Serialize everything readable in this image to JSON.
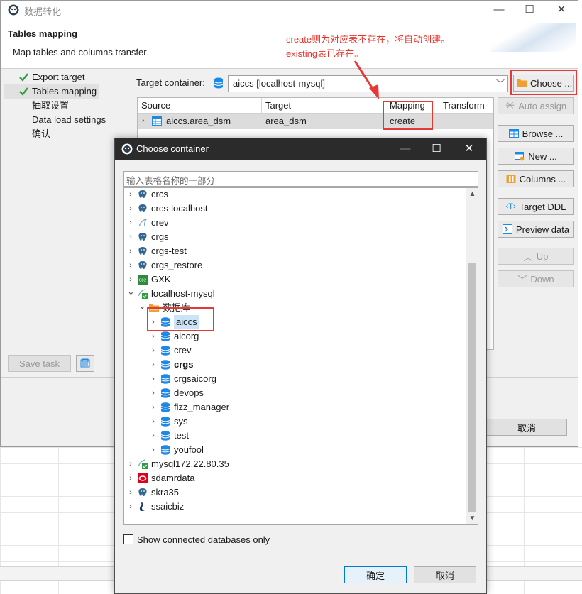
{
  "window": {
    "title": "数据转化",
    "controls": [
      "—",
      "☐",
      "✕"
    ]
  },
  "header": {
    "title": "Tables mapping",
    "subtitle": "Map tables and columns transfer"
  },
  "annotation": {
    "line1": "create则为对应表不存在，将自动创建。",
    "line2": "existing表已存在。"
  },
  "steps": [
    {
      "label": "Export target",
      "done": true
    },
    {
      "label": "Tables mapping",
      "done": true,
      "active": true
    },
    {
      "label": "抽取设置",
      "done": false
    },
    {
      "label": "Data load settings",
      "done": false
    },
    {
      "label": "确认",
      "done": false
    }
  ],
  "target_container": {
    "label": "Target container:",
    "value": "aiccs  [localhost-mysql]"
  },
  "choose_button": "Choose ...",
  "table": {
    "columns": [
      "Source",
      "Target",
      "Mapping",
      "Transform"
    ],
    "rows": [
      {
        "source": "aiccs.area_dsm",
        "target": "area_dsm",
        "mapping": "create",
        "transform": ""
      }
    ]
  },
  "right_buttons": {
    "auto_assign": "Auto assign",
    "browse": "Browse ...",
    "new": "New ...",
    "columns": "Columns ...",
    "target_ddl": "Target DDL",
    "preview": "Preview data",
    "up": "Up",
    "down": "Down"
  },
  "save_task": "Save task",
  "main_cancel": "取消",
  "dialog": {
    "title": "Choose container",
    "filter_placeholder": "输入表格名称的一部分",
    "tree": [
      {
        "label": "crcs",
        "icon": "postgres"
      },
      {
        "label": "crcs-localhost",
        "icon": "postgres"
      },
      {
        "label": "crev",
        "icon": "mysql"
      },
      {
        "label": "crgs",
        "icon": "postgres"
      },
      {
        "label": "crgs-test",
        "icon": "postgres"
      },
      {
        "label": "crgs_restore",
        "icon": "postgres"
      },
      {
        "label": "GXK",
        "icon": "green"
      },
      {
        "label": "localhost-mysql",
        "icon": "mysql-connected",
        "expanded": true
      },
      {
        "label": "数据库",
        "icon": "folder",
        "expanded": true
      },
      {
        "label": "aiccs",
        "icon": "database",
        "selected": true
      },
      {
        "label": "aicorg",
        "icon": "database"
      },
      {
        "label": "crev",
        "icon": "database"
      },
      {
        "label": "crgs",
        "icon": "database",
        "bold": true
      },
      {
        "label": "crgsaicorg",
        "icon": "database"
      },
      {
        "label": "devops",
        "icon": "database"
      },
      {
        "label": "fizz_manager",
        "icon": "database"
      },
      {
        "label": "sys",
        "icon": "database"
      },
      {
        "label": "test",
        "icon": "database"
      },
      {
        "label": "youfool",
        "icon": "database"
      },
      {
        "label": "mysql172.22.80.35",
        "icon": "mysql-connected"
      },
      {
        "label": "sdamrdata",
        "icon": "oracle"
      },
      {
        "label": "skra35",
        "icon": "postgres"
      },
      {
        "label": "ssaicbiz",
        "icon": "sybase"
      }
    ],
    "show_connected_only": "Show connected databases only",
    "ok": "确定",
    "cancel": "取消"
  },
  "colors": {
    "annotation_red": "#e53935",
    "accent_blue": "#1e88e5",
    "check_green": "#2e9e3e",
    "folder_orange": "#f0a030"
  }
}
